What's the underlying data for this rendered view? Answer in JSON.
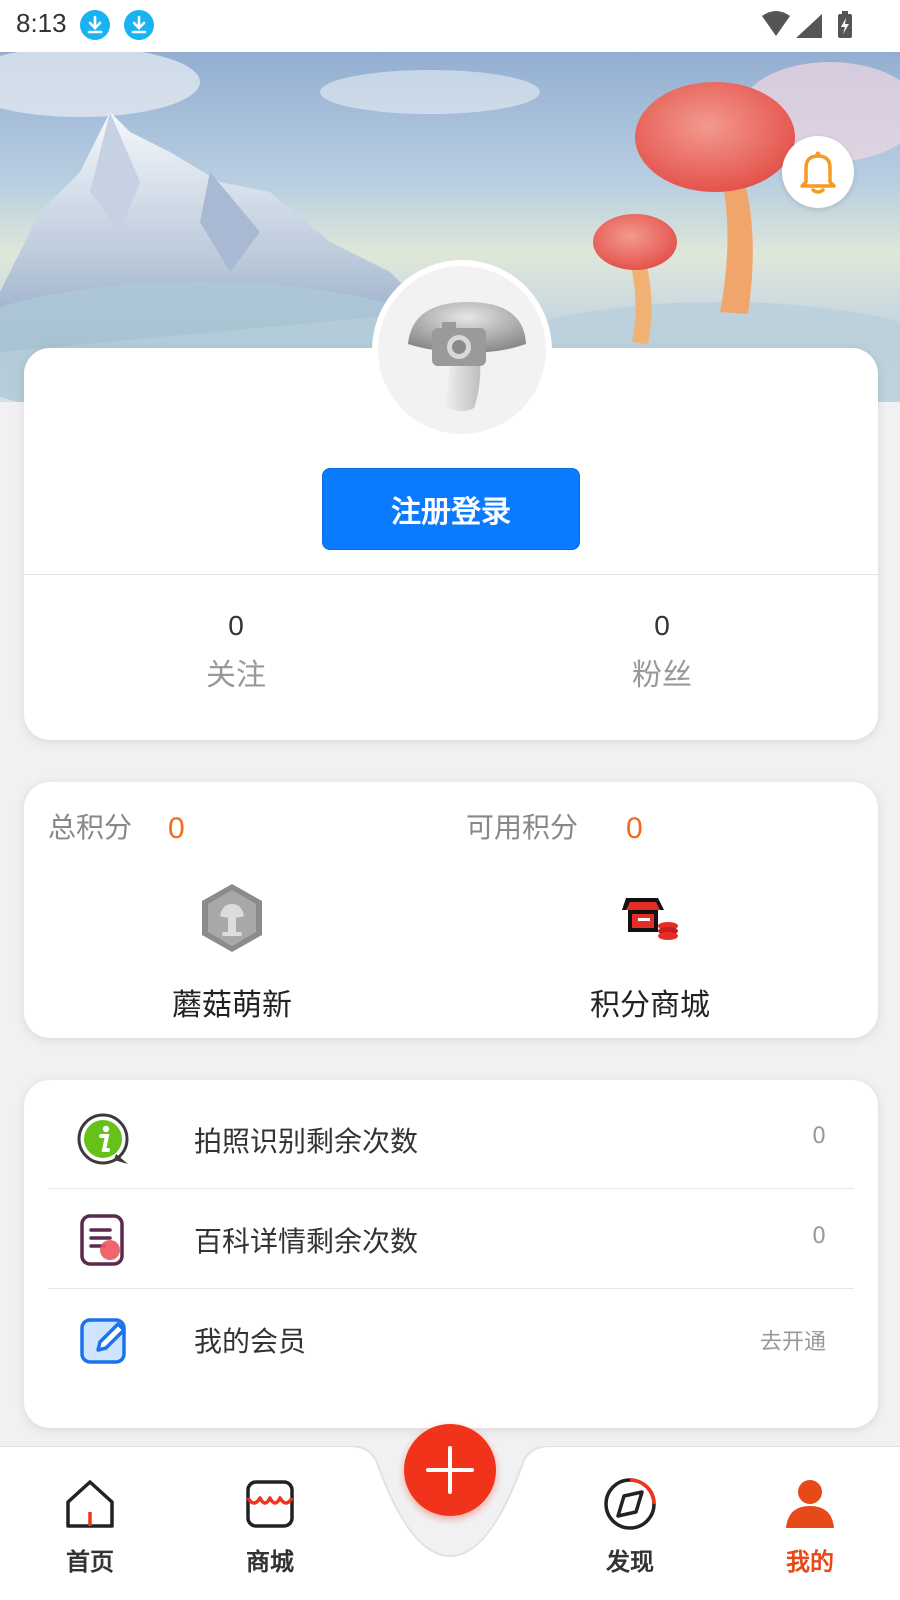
{
  "status_bar": {
    "time": "8:13"
  },
  "profile": {
    "login_button": "注册登录",
    "following_count": "0",
    "following_label": "关注",
    "fans_count": "0",
    "fans_label": "粉丝"
  },
  "points": {
    "total_label": "总积分",
    "total_value": "0",
    "available_label": "可用积分",
    "available_value": "0",
    "level_label": "蘑菇萌新",
    "shop_label": "积分商城"
  },
  "list": [
    {
      "icon": "info-chat-icon",
      "label": "拍照识别剩余次数",
      "value": "0"
    },
    {
      "icon": "document-icon",
      "label": "百科详情剩余次数",
      "value": "0"
    },
    {
      "icon": "edit-icon",
      "label": "我的会员",
      "value": "去开通"
    }
  ],
  "nav": {
    "home": "首页",
    "shop": "商城",
    "discover": "发现",
    "mine": "我的"
  },
  "colors": {
    "accent_blue": "#0a7bff",
    "accent_orange": "#f26a1b",
    "fab_red": "#f0331a",
    "nav_active": "#e64a19"
  }
}
